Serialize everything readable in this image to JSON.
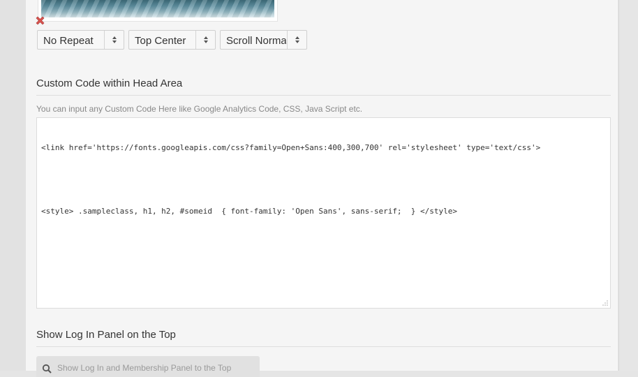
{
  "background_selects": [
    {
      "value": "No Repeat"
    },
    {
      "value": "Top Center"
    },
    {
      "value": "Scroll Normal"
    }
  ],
  "custom_code": {
    "title": "Custom Code within Head Area",
    "description": "You can input any Custom Code Here like Google Analytics Code, CSS, Java Script etc.",
    "line1": "<link href='https://fonts.googleapis.com/css?family=Open+Sans:400,300,700' rel='stylesheet' type='text/css'>",
    "line2": "<style> .sampleclass, h1, h2, #someid  { font-family: 'Open Sans', sans-serif;  } </style>"
  },
  "login_panel": {
    "title": "Show Log In Panel on the Top",
    "select_text": "Show Log In and Membership Panel to the Top"
  },
  "colors": {
    "remove_icon": "#d9534f",
    "panel_bg": "#f5f5f5"
  }
}
